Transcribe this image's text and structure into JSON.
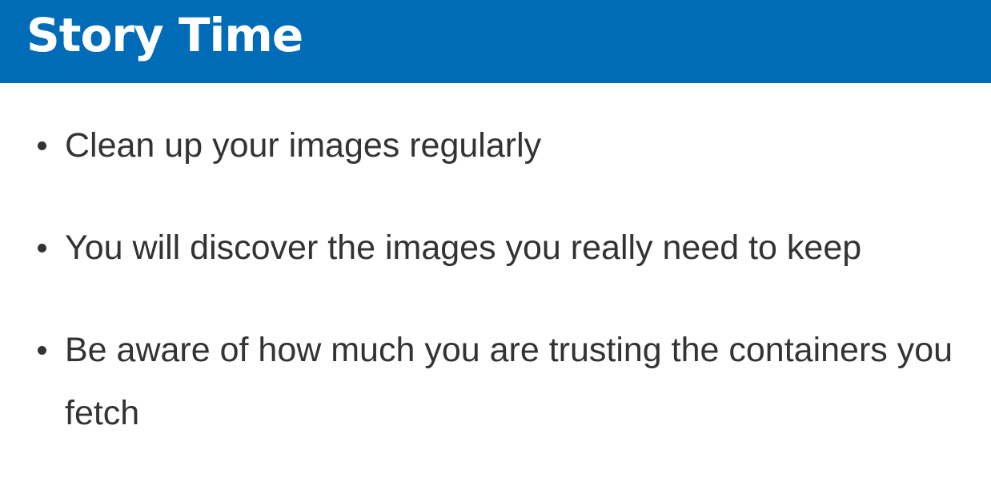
{
  "slide": {
    "title": "Story Time",
    "bullets": [
      "Clean up your images regularly",
      "You will discover the images you really need to keep",
      "Be aware of how much you are trusting the containers you fetch"
    ]
  },
  "colors": {
    "title_bar": "#006bb6",
    "title_text": "#ffffff",
    "body_text": "#333333",
    "background": "#ffffff"
  }
}
